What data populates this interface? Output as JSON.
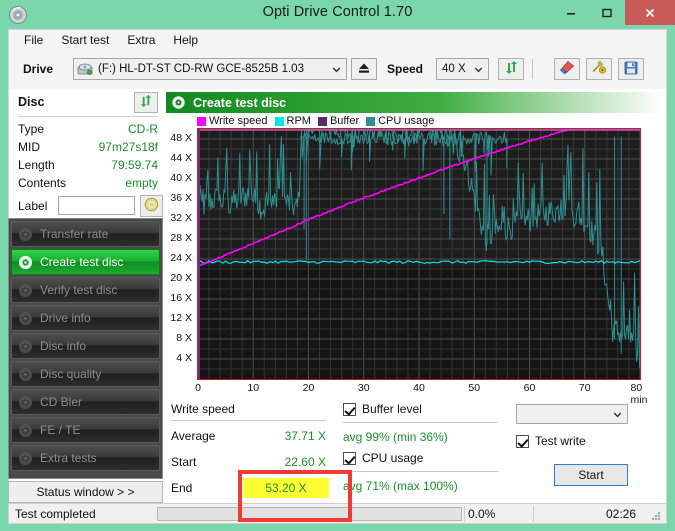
{
  "window": {
    "title": "Opti Drive Control 1.70",
    "icon": "disc-icon",
    "minimize_label": "–",
    "maximize_label": "□",
    "close_label": "✕"
  },
  "menu": {
    "items": [
      {
        "label": "File",
        "name": "menu-file"
      },
      {
        "label": "Start test",
        "name": "menu-start-test"
      },
      {
        "label": "Extra",
        "name": "menu-extra"
      },
      {
        "label": "Help",
        "name": "menu-help"
      }
    ]
  },
  "toolbar": {
    "drive_label": "Drive",
    "drive_value": "(F:)  HL-DT-ST CD-RW GCE-8525B 1.03",
    "drive_icon": "drive-icon",
    "eject_icon": "eject-icon",
    "speed_label": "Speed",
    "speed_value": "40 X",
    "refresh_icon": "refresh-arrows-icon",
    "erase_icon": "erase-disc-icon",
    "tools_icon": "tools-icon",
    "save_icon": "save-icon"
  },
  "disc_panel": {
    "header": "Disc",
    "refresh_icon": "refresh-arrows-icon",
    "rows": [
      {
        "key": "Type",
        "value": "CD-R"
      },
      {
        "key": "MID",
        "value": "97m27s18f"
      },
      {
        "key": "Length",
        "value": "79:59.74"
      },
      {
        "key": "Contents",
        "value": "empty"
      }
    ],
    "label_key": "Label",
    "label_value": "",
    "label_placeholder": "",
    "label_button_icon": "cd-icon"
  },
  "sidebar": {
    "items": [
      {
        "label": "Transfer rate",
        "name": "sidebar-item-transfer-rate",
        "active": false,
        "icon": "disc-test-icon"
      },
      {
        "label": "Create test disc",
        "name": "sidebar-item-create-test-disc",
        "active": true,
        "icon": "disc-write-icon"
      },
      {
        "label": "Verify test disc",
        "name": "sidebar-item-verify-test-disc",
        "active": false,
        "icon": "disc-verify-icon"
      },
      {
        "label": "Drive info",
        "name": "sidebar-item-drive-info",
        "active": false,
        "icon": "drive-info-icon"
      },
      {
        "label": "Disc info",
        "name": "sidebar-item-disc-info",
        "active": false,
        "icon": "disc-info-icon"
      },
      {
        "label": "Disc quality",
        "name": "sidebar-item-disc-quality",
        "active": false,
        "icon": "disc-quality-icon"
      },
      {
        "label": "CD Bler",
        "name": "sidebar-item-cd-bler",
        "active": false,
        "icon": "disc-bler-icon"
      },
      {
        "label": "FE / TE",
        "name": "sidebar-item-fe-te",
        "active": false,
        "icon": "disc-fete-icon"
      },
      {
        "label": "Extra tests",
        "name": "sidebar-item-extra-tests",
        "active": false,
        "icon": "disc-extra-icon"
      }
    ],
    "status_window_label": "Status window > >"
  },
  "chart_panel": {
    "header": "Create test disc",
    "header_icon": "disc-write-icon"
  },
  "chart_data": {
    "type": "line",
    "title": "Create test disc",
    "xlabel": "min",
    "ylabel": "X",
    "xlim": [
      0,
      80
    ],
    "ylim": [
      0,
      50
    ],
    "xticks": [
      0,
      10,
      20,
      30,
      40,
      50,
      60,
      70,
      80
    ],
    "xtick_labels": [
      "0",
      "10",
      "20",
      "30",
      "40",
      "50",
      "60",
      "70",
      "80 min"
    ],
    "yticks": [
      4,
      8,
      12,
      16,
      20,
      24,
      28,
      32,
      36,
      40,
      44,
      48
    ],
    "ytick_labels": [
      "4 X",
      "8 X",
      "12 X",
      "16 X",
      "20 X",
      "24 X",
      "28 X",
      "32 X",
      "36 X",
      "40 X",
      "44 X",
      "48 X"
    ],
    "grid": true,
    "legend_position": "top-left",
    "background": "#151515",
    "border_color": "#c02020",
    "legend": [
      {
        "name": "Write speed",
        "color": "#ff00ff"
      },
      {
        "name": "RPM",
        "color": "#00e5e5"
      },
      {
        "name": "Buffer",
        "color": "#5a2a6e"
      },
      {
        "name": "CPU usage",
        "color": "#2f8f8f"
      }
    ],
    "series": [
      {
        "name": "Write speed",
        "color": "#ff00ff",
        "x": [
          0,
          2,
          5,
          8,
          11,
          14,
          17,
          20,
          24,
          28,
          32,
          36,
          40,
          44,
          48,
          52,
          56,
          60,
          64,
          68,
          72,
          76,
          80
        ],
        "values": [
          22.6,
          23.4,
          24.8,
          26.2,
          27.6,
          29.0,
          30.4,
          31.9,
          33.6,
          35.4,
          37.0,
          38.6,
          40.2,
          41.8,
          43.3,
          44.8,
          46.2,
          47.6,
          48.9,
          50.2,
          51.4,
          52.4,
          53.2
        ]
      },
      {
        "name": "RPM",
        "color": "#00e5e5",
        "x": [
          0,
          10,
          20,
          30,
          40,
          50,
          60,
          70,
          80
        ],
        "values": [
          23.4,
          23.4,
          23.4,
          23.4,
          23.4,
          23.4,
          23.4,
          23.4,
          23.4
        ]
      },
      {
        "name": "CPU usage",
        "color": "#2f8f8f",
        "x": [
          0,
          3,
          6,
          9,
          12,
          15,
          18,
          19,
          20,
          24,
          28,
          32,
          36,
          40,
          44,
          48,
          52,
          55,
          58,
          62,
          66,
          70,
          73,
          75,
          77,
          79,
          80
        ],
        "values": [
          34,
          36,
          35,
          37,
          34,
          36,
          34,
          47,
          50,
          50,
          49,
          50,
          48,
          50,
          49,
          45,
          28,
          30,
          31,
          33,
          34,
          32,
          26,
          10,
          9,
          7,
          3
        ]
      }
    ]
  },
  "stats": {
    "write_speed_header": "Write speed",
    "rows": [
      {
        "key": "Average",
        "value": "37.71 X",
        "highlighted": false
      },
      {
        "key": "Start",
        "value": "22.60 X",
        "highlighted": false
      },
      {
        "key": "End",
        "value": "53.20 X",
        "highlighted": true
      }
    ],
    "buffer_checkbox_label": "Buffer level",
    "buffer_checked": true,
    "buffer_note": "avg 99% (min 36%)",
    "cpu_checkbox_label": "CPU usage",
    "cpu_checked": true,
    "cpu_note": "avg 71% (max 100%)",
    "select_value": "",
    "test_write_label": "Test write",
    "test_write_checked": true,
    "start_button_label": "Start"
  },
  "statusbar": {
    "message": "Test completed",
    "progress_percent": "0.0%",
    "progress_value": 0,
    "elapsed": "02:26"
  },
  "colors": {
    "window_chrome": "#7ad6ab",
    "accent_green": "#1a8f2a",
    "close_red": "#c85a5a",
    "annotation_red": "#ee3b33",
    "highlight_yellow": "#ffff33"
  }
}
